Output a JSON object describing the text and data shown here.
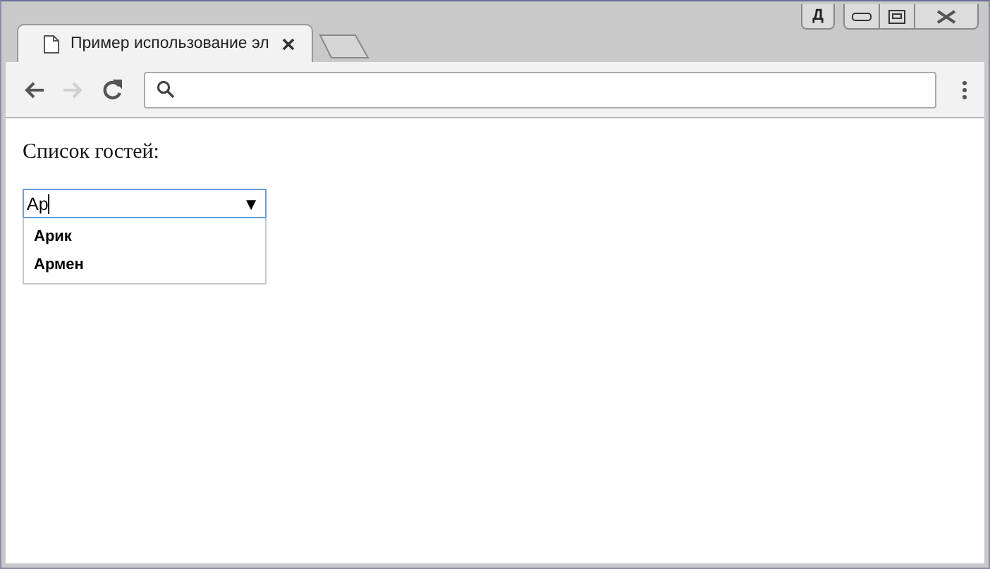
{
  "window": {
    "profile_label": "Д"
  },
  "tabs": [
    {
      "title": "Пример использование эл",
      "selected": true
    }
  ],
  "toolbar": {
    "nav_buttons": [
      {
        "kind": "back",
        "disabled": false
      },
      {
        "kind": "forward",
        "disabled": true
      },
      {
        "kind": "reload",
        "disabled": false
      }
    ]
  },
  "page": {
    "label": "Список гостей:",
    "combo": {
      "value": "Ар",
      "arrow": "▼",
      "suggestions": [
        "Арик",
        "Армен"
      ]
    }
  }
}
